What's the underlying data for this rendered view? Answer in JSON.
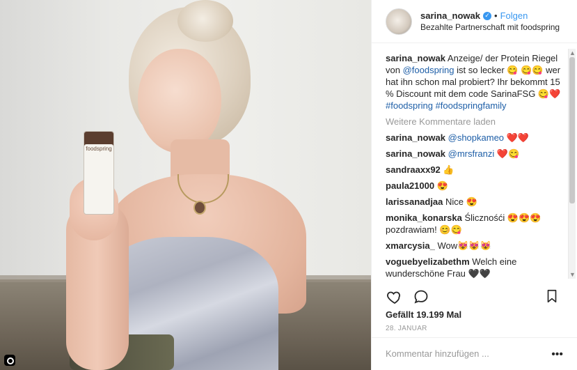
{
  "header": {
    "username": "sarina_nowak",
    "follow_label": "Folgen",
    "dot": "•",
    "partner_text": "Bezahlte Partnerschaft mit foodspring"
  },
  "photo": {
    "bar_brand": "foodspring"
  },
  "caption": {
    "user": "sarina_nowak",
    "text_part1": "Anzeige/ der Protein Riegel von ",
    "mention": "@foodspring",
    "text_part2": " ist so lecker 😋 😋😋 wer hat ihn schon mal probiert? Ihr bekommt 15 % Discount mit dem code SarinaFSG 😋❤️ ",
    "hashtag1": "#foodspring",
    "hashtag2": "#foodspringfamily"
  },
  "more_comments_label": "Weitere Kommentare laden",
  "comments": [
    {
      "user": "sarina_nowak",
      "mention": "@shopkameo",
      "text": " ❤️❤️"
    },
    {
      "user": "sarina_nowak",
      "mention": "@mrsfranzi",
      "text": " ❤️😋"
    },
    {
      "user": "sandraaxx92",
      "mention": "",
      "text": " 👍"
    },
    {
      "user": "paula21000",
      "mention": "",
      "text": " 😍"
    },
    {
      "user": "larissanadjaa",
      "mention": "",
      "text": " Nice 😍"
    },
    {
      "user": "monika_konarska",
      "mention": "",
      "text": " Ślicznośći 😍😍😍 pozdrawiam! 😊😋"
    },
    {
      "user": "xmarcysia_",
      "mention": "",
      "text": " Wow😻😻😻"
    },
    {
      "user": "voguebyelizabethm",
      "mention": "",
      "text": " Welch eine wunderschöne Frau 🖤🖤"
    }
  ],
  "likes_text": "Gefällt 19.199 Mal",
  "date_text": "28. JANUAR",
  "comment_placeholder": "Kommentar hinzufügen ...",
  "more_dots": "•••",
  "colors": {
    "link": "#1d5ea7",
    "follow": "#3897f0",
    "muted": "#999999"
  }
}
